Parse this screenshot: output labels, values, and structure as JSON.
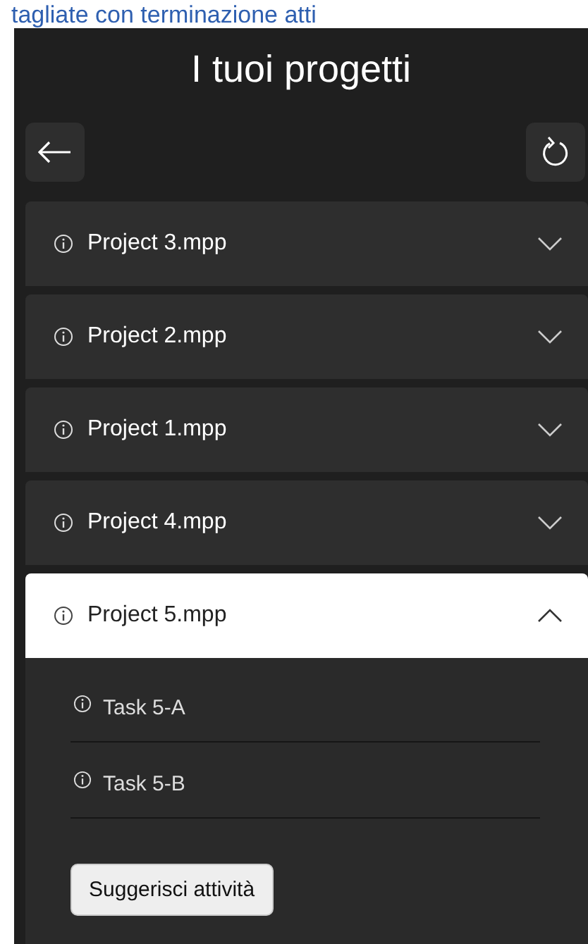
{
  "caption": "tagliate con terminazione atti",
  "title": "I tuoi progetti",
  "projects": [
    {
      "name": "Project 3.mpp",
      "expanded": false
    },
    {
      "name": "Project 2.mpp",
      "expanded": false
    },
    {
      "name": "Project 1.mpp",
      "expanded": false
    },
    {
      "name": "Project 4.mpp",
      "expanded": false
    },
    {
      "name": "Project 5.mpp",
      "expanded": true,
      "tasks": [
        "Task 5-A",
        "Task 5-B"
      ],
      "button": "Suggerisci attività"
    }
  ]
}
